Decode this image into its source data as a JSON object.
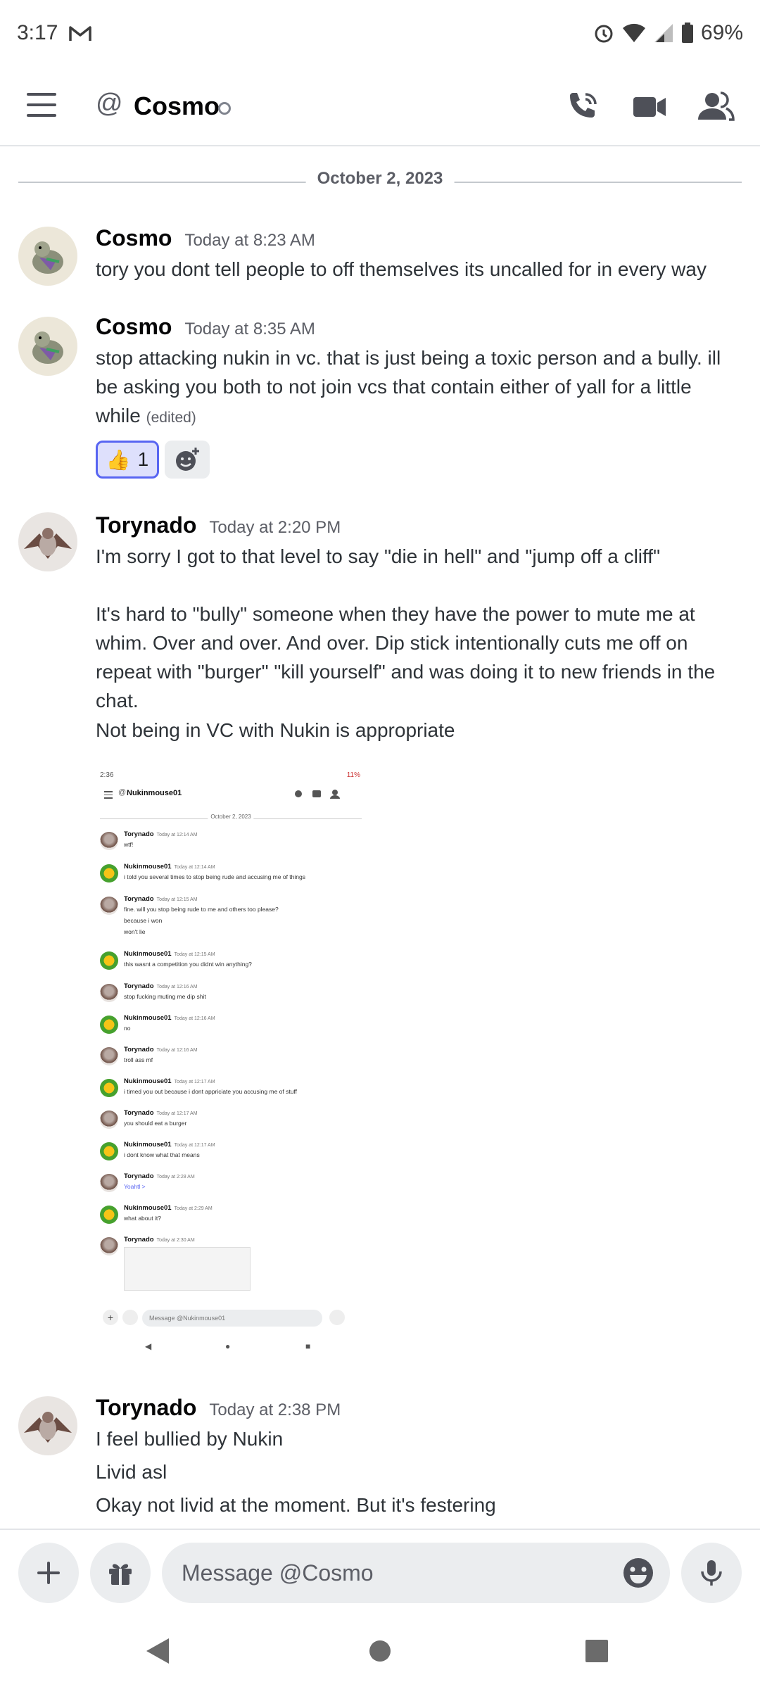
{
  "status_bar": {
    "time": "3:17",
    "battery": "69%",
    "icons": [
      "gmail-icon",
      "alarm-icon",
      "wifi-icon",
      "signal-icon",
      "battery-icon"
    ]
  },
  "header": {
    "channel_prefix_icon": "at-icon",
    "title": "Cosmo",
    "icons": [
      "menu-icon",
      "call-icon",
      "video-icon",
      "profile-icon"
    ]
  },
  "date_divider": "October 2, 2023",
  "messages": [
    {
      "author": "Cosmo",
      "timestamp": "Today at 8:23 AM",
      "lines": [
        "tory you dont tell people to off themselves its uncalled for in every way"
      ]
    },
    {
      "author": "Cosmo",
      "timestamp": "Today at 8:35 AM",
      "lines": [
        "stop attacking nukin in vc. that is just being a toxic person and a bully. ill",
        "be asking you both to not join vcs that contain either of yall for a little",
        "while"
      ],
      "edited": "(edited)",
      "reaction": {
        "emoji": "👍",
        "count": "1"
      }
    },
    {
      "author": "Torynado",
      "timestamp": "Today at 2:20 PM",
      "lines": [
        "I'm sorry I got to that level to say \"die in hell\" and \"jump off a cliff\"",
        "It's hard to \"bully\" someone when they have the power to mute me at",
        "whim.  Over and over.  And over.  Dip stick intentionally cuts me off on",
        "repeat with \"burger\" \"kill yourself\" and was doing it to new friends in the",
        "chat.",
        "Not being in VC with Nukin is appropriate"
      ]
    },
    {
      "author": "Torynado",
      "timestamp": "Today at 2:38 PM",
      "lines": [
        "I feel bullied by Nukin",
        "Livid asl",
        "Okay not livid at the moment.  But it's festering"
      ]
    }
  ],
  "attachment": {
    "status_time": "2:36",
    "status_battery": "11%",
    "title": "Nukinmouse01",
    "date": "October 2, 2023",
    "messages": [
      {
        "author": "Torynado",
        "timestamp": "Today at 12:14 AM",
        "lines": [
          "wtf!"
        ]
      },
      {
        "author": "Nukinmouse01",
        "timestamp": "Today at 12:14 AM",
        "lines": [
          "i told you several times to stop being rude and accusing me of things"
        ]
      },
      {
        "author": "Torynado",
        "timestamp": "Today at 12:15 AM",
        "lines": [
          "fine.  will you stop being rude to me and others too please?",
          "because i won",
          "won't lie"
        ]
      },
      {
        "author": "Nukinmouse01",
        "timestamp": "Today at 12:15 AM",
        "lines": [
          "this wasnt a competition you didnt win anything?"
        ]
      },
      {
        "author": "Torynado",
        "timestamp": "Today at 12:16 AM",
        "lines": [
          "stop fucking muting me dip shit"
        ]
      },
      {
        "author": "Nukinmouse01",
        "timestamp": "Today at 12:16 AM",
        "lines": [
          "no"
        ]
      },
      {
        "author": "Torynado",
        "timestamp": "Today at 12:16 AM",
        "lines": [
          "troll ass mf"
        ]
      },
      {
        "author": "Nukinmouse01",
        "timestamp": "Today at 12:17 AM",
        "lines": [
          "i timed you out because i dont appriciate you accusing me of stuff"
        ]
      },
      {
        "author": "Torynado",
        "timestamp": "Today at 12:17 AM",
        "lines": [
          "you  should eat a burger"
        ]
      },
      {
        "author": "Nukinmouse01",
        "timestamp": "Today at 12:17 AM",
        "lines": [
          "i dont know what that means"
        ]
      },
      {
        "author": "Torynado",
        "timestamp": "Today at 2:28 AM",
        "lines": [
          "Yoahtl >"
        ]
      },
      {
        "author": "Nukinmouse01",
        "timestamp": "Today at 2:29 AM",
        "lines": [
          "what about it?"
        ]
      },
      {
        "author": "Torynado",
        "timestamp": "Today at 2:30 AM",
        "lines": []
      }
    ],
    "input_placeholder": "Message @Nukinmouse01"
  },
  "composer": {
    "placeholder": "Message @Cosmo",
    "icons": [
      "plus-icon",
      "gift-icon",
      "emoji-icon",
      "microphone-icon"
    ]
  },
  "nav_bar": {
    "icons": [
      "back-icon",
      "home-icon",
      "recents-icon"
    ]
  },
  "colors": {
    "accent": "#5865f2",
    "reaction_bg": "#dee0fc",
    "muted_text": "#5c5e66",
    "input_bg": "#ebedef"
  }
}
